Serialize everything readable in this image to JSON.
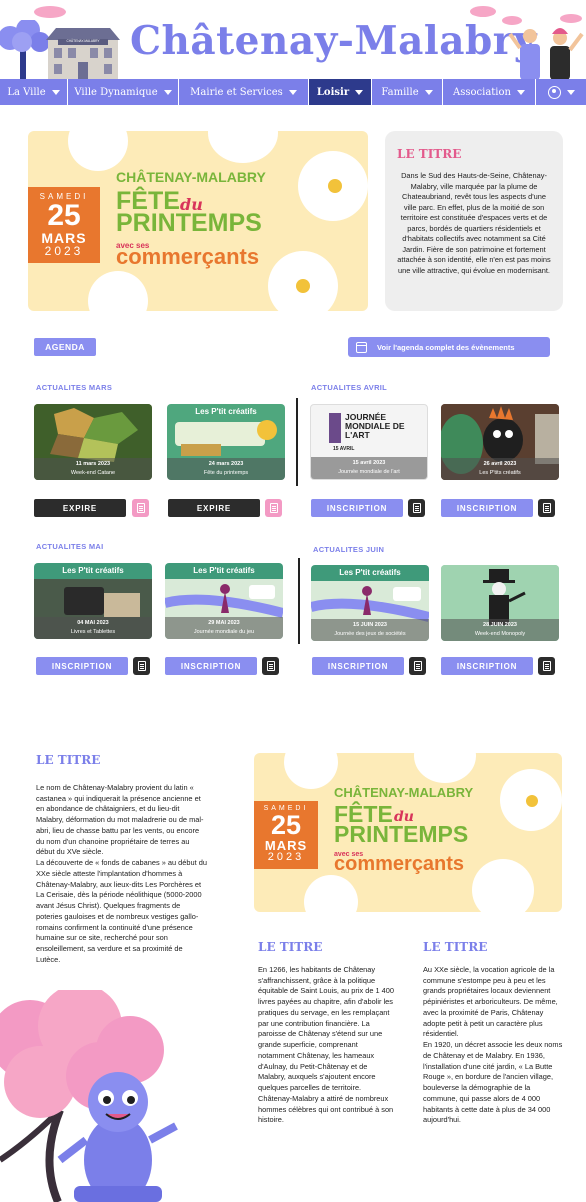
{
  "header": {
    "title": "Châtenay-Malabry",
    "castle_sign": "CHÂTENAY-MALABRY"
  },
  "nav": {
    "items": [
      {
        "label": "La Ville"
      },
      {
        "label": "Ville Dynamique"
      },
      {
        "label": "Mairie et Services"
      },
      {
        "label": "Loisir"
      },
      {
        "label": "Famille"
      },
      {
        "label": "Association"
      }
    ],
    "active": "Loisir",
    "user_icon": "user-circle-icon"
  },
  "hero_poster": {
    "day_name": "SAMEDI",
    "day": "25",
    "month": "MARS",
    "year": "2023",
    "brand": "CHÂTENAY-MALABRY",
    "line1": "FÊTE",
    "line2": "du",
    "line3": "PRINTEMPS",
    "avec": "avec ses",
    "commercants": "commerçants"
  },
  "intro": {
    "title": "LE TITRE",
    "text": "Dans le Sud des Hauts-de-Seine, Châtenay-Malabry, ville marquée par la plume de Chateaubriand, revêt tous les aspects d'une ville parc. En effet, plus de la moitié de son territoire est constituée d'espaces verts et de parcs, bordés de quartiers résidentiels et d'habitats collectifs avec notamment sa Cité Jardin. Fière de son patrimoine et fortement attachée à son identité, elle n'en est pas moins une ville attractive, qui évolue en modernisant."
  },
  "agenda": {
    "badge": "AGENDA",
    "link_label": "Voir l'agenda complet des évènements",
    "sections": [
      {
        "label": "ACTUALITES MARS",
        "events": [
          {
            "date": "11 mars 2023",
            "name": "Week-end Catane",
            "top": "",
            "button": "EXPIRE"
          },
          {
            "date": "24 mars 2023",
            "name": "Fête du printemps",
            "top": "Les P'tit créatifs",
            "button": "EXPIRE"
          }
        ]
      },
      {
        "label": "ACTUALITES AVRIL",
        "events": [
          {
            "date": "15 avril 2023",
            "name": "Journée mondiale de l'art",
            "top": "",
            "poster_text": "JOURNÉE MONDIALE DE L'ART",
            "poster_date": "15 AVRIL",
            "button": "INSCRIPTION"
          },
          {
            "date": "26 avril 2023",
            "name": "Les P'tits créatifs",
            "top": "",
            "button": "INSCRIPTION"
          }
        ]
      },
      {
        "label": "ACTUALITES MAI",
        "events": [
          {
            "date": "04 MAI 2023",
            "name": "Livres et Tablettes",
            "top": "Les P'tit créatifs",
            "button": "INSCRIPTION"
          },
          {
            "date": "29 MAI 2023",
            "name": "Journée mondiale du jeu",
            "top": "Les P'tit créatifs",
            "button": "INSCRIPTION"
          }
        ]
      },
      {
        "label": "ACTUALITES JUIN",
        "events": [
          {
            "date": "15 JUIN 2023",
            "name": "Journée des jeux de sociétés",
            "top": "Les P'tit créatifs",
            "button": "INSCRIPTION"
          },
          {
            "date": "28 JUIN 2023",
            "name": "Week-end Monopoly",
            "top": "",
            "button": "INSCRIPTION"
          }
        ]
      }
    ]
  },
  "article": {
    "left_title": "LE TITRE",
    "left_text": "Le nom de Châtenay-Malabry provient du latin « castanea » qui indiquerait la présence ancienne et en abondance de châtaigniers, et du lieu-dit Malabry, déformation du mot maladrerie ou de mal-abri, lieu de chasse battu par les vents, ou encore du nom d'un chanoine propriétaire de terres au début du XVe siècle.\nLa découverte de « fonds de cabanes » au début du XXe siècle atteste l'implantation d'hommes à Châtenay-Malabry, aux lieux-dits Les Porchères et La Cerisaie, dès la période néolithique (5000-2000 avant Jésus Christ). Quelques fragments de poteries gauloises et de nombreux vestiges gallo-romains confirment la continuité d'une présence humaine sur ce site, recherché pour son ensoleillement, sa verdure et sa proximité de Lutèce.",
    "mid_title": "LE TITRE",
    "mid_text": "En 1266, les habitants de Châtenay s'affranchissent, grâce à la politique équitable de Saint Louis, au prix de 1 400 livres payées au chapitre, afin d'abolir les pratiques du servage, en les remplaçant par une contribution financière. La paroisse de Châtenay s'étend sur une grande superficie, comprenant notamment Châtenay, les hameaux d'Aulnay, du Petit-Châtenay et de Malabry, auxquels s'ajoutent encore quelques parcelles de territoire. Châtenay-Malabry a attiré de nombreux hommes célèbres qui ont contribué à son histoire.",
    "right_title": "LE TITRE",
    "right_text": "Au XXe siècle, la vocation agricole de la commune s'estompe peu à peu et les grands propriétaires locaux deviennent pépiniéristes et arboriculteurs. De même, avec la proximité de Paris, Châtenay adopte petit à petit un caractère plus résidentiel.\nEn 1920, un décret associe les deux noms de Châtenay et de Malabry. En 1936, l'installation d'une cité jardin, « La Butte Rouge », en bordure de l'ancien village, bouleverse la démographie de la commune, qui passe alors de 4 000 habitants à cette date à plus de 34 000 aujourd'hui."
  },
  "colors": {
    "primary": "#7b7fe9",
    "nav_active": "#2d3a8c",
    "accent_pink": "#e35a8c",
    "orange": "#e8772e",
    "green": "#79b53a"
  }
}
